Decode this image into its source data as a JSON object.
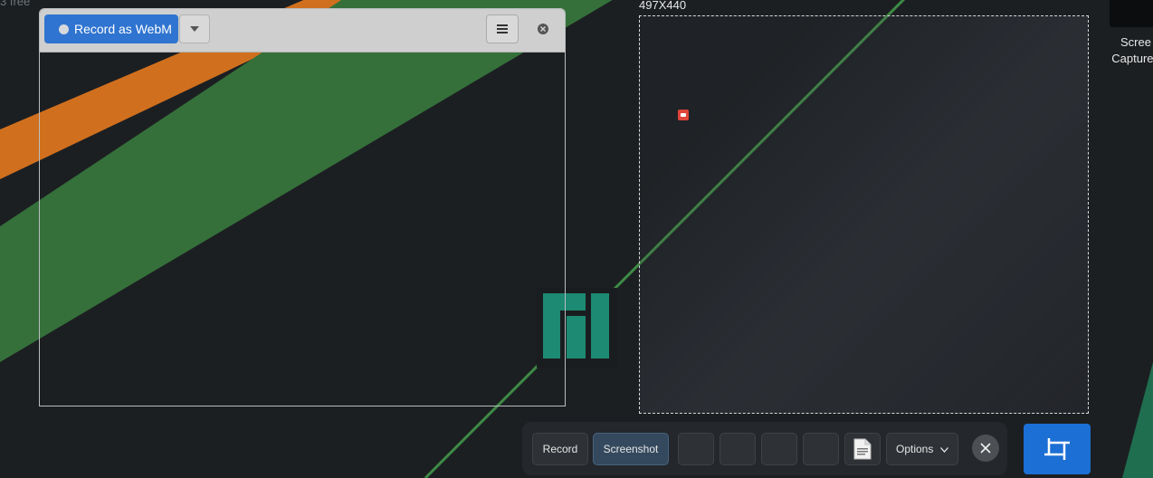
{
  "desktop": {
    "partial_label": "3 free",
    "file_icon": {
      "icon": "video-thumbnail-icon",
      "label_line1": "Scree",
      "label_line2": "Capture_"
    }
  },
  "recorder": {
    "record_label": "Record as WebM",
    "dropdown_icon": "caret-down-icon",
    "menu_icon": "hamburger-menu-icon",
    "close_icon": "close-circle-icon"
  },
  "selection": {
    "size_label": "497X440"
  },
  "toolbar": {
    "record_label": "Record",
    "screenshot_label": "Screenshot",
    "options_label": "Options",
    "doc_icon": "document-icon",
    "close_icon": "close-icon"
  },
  "crop_button": {
    "icon": "crop-icon"
  },
  "colors": {
    "accent_blue": "#2f74d0",
    "crop_blue": "#1c6fd4",
    "wallpaper_orange": "#d0701e",
    "wallpaper_green": "#35703a",
    "logo_teal": "#1d8a73"
  }
}
